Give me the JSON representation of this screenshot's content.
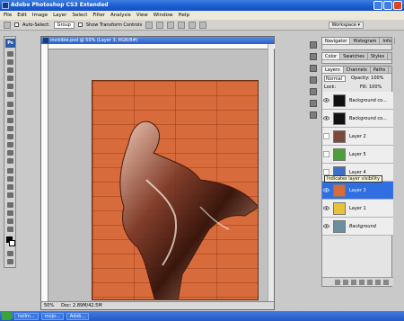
{
  "app": {
    "title": "Adobe Photoshop CS3 Extended",
    "menu": [
      "File",
      "Edit",
      "Image",
      "Layer",
      "Select",
      "Filter",
      "Analysis",
      "View",
      "Window",
      "Help"
    ]
  },
  "options": {
    "auto_select_label": "Auto-Select:",
    "auto_select_value": "Group",
    "show_transform_label": "Show Transform Controls",
    "workspace_label": "Workspace ▾"
  },
  "toolbox": {
    "logo": "Ps"
  },
  "document": {
    "title": "invisible.psd @ 50% (Layer 3, RGB/8#)",
    "zoom": "50%",
    "doc_size": "Doc: 2.89M/42.5M"
  },
  "panels": {
    "group1_tabs": [
      "Navigator",
      "Histogram",
      "Info"
    ],
    "group2_tabs": [
      "Color",
      "Swatches",
      "Styles"
    ],
    "layers_tabs": [
      "Layers",
      "Channels",
      "Paths"
    ],
    "blend_mode": "Normal",
    "opacity_label": "Opacity: 100%",
    "lock_label": "Lock:",
    "fill_label": "Fill: 100%",
    "layers": [
      {
        "name": "Background co...",
        "thumb": "dark",
        "visible": true
      },
      {
        "name": "Background co...",
        "thumb": "dark",
        "visible": true
      },
      {
        "name": "Layer 2",
        "thumb": "#7b4a3a",
        "visible": false
      },
      {
        "name": "Layer 5",
        "thumb": "#4f9e3c",
        "visible": false
      },
      {
        "name": "Layer 4",
        "thumb": "#3f6fc4",
        "visible": false
      },
      {
        "name": "Layer 3",
        "thumb": "#d86b3b",
        "visible": true,
        "selected": true
      },
      {
        "name": "Layer 1",
        "thumb": "#e8c33a",
        "visible": true
      },
      {
        "name": "Background",
        "thumb": "#6a8fa0",
        "visible": true
      }
    ]
  },
  "tooltip": "Indicates layer visibility",
  "taskbar": {
    "start": "",
    "buttons": [
      "hollm...",
      "mojo...",
      "Adob..."
    ]
  },
  "colors": {
    "accent": "#2f6fe2",
    "artboard": "#d86b3b"
  }
}
